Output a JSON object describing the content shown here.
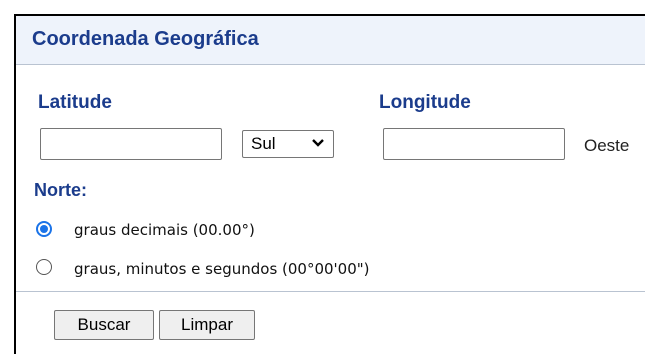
{
  "form": {
    "title": "Coordenada Geográfica",
    "latitude": {
      "label": "Latitude",
      "value": "",
      "hemisphere": "Sul"
    },
    "longitude": {
      "label": "Longitude",
      "value": "",
      "hemisphere": "Oeste"
    },
    "north_label": "Norte:",
    "format_options": [
      {
        "label": "graus decimais (00.00°)",
        "selected": true
      },
      {
        "label": "graus, minutos e segundos (00°00'00\")",
        "selected": false
      }
    ],
    "buttons": {
      "search": "Buscar",
      "clear": "Limpar"
    }
  },
  "colors": {
    "heading": "#1b3c8c",
    "title_bar_bg": "#eef3fb",
    "radio_accent": "#1a73e8"
  }
}
